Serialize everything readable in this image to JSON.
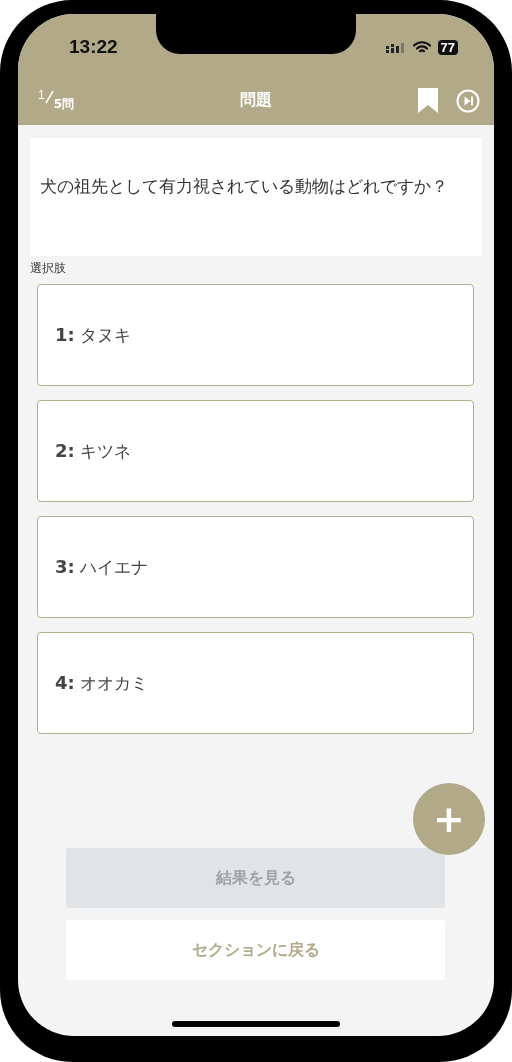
{
  "status_bar": {
    "time": "13:22",
    "battery": "77"
  },
  "header": {
    "counter_current": "1",
    "counter_total": "5問",
    "title": "問題"
  },
  "question": "犬の祖先として有力視されている動物はどれですか？",
  "choices_label": "選択肢",
  "choices": [
    {
      "number": "1:",
      "label": "タヌキ",
      "selected": false
    },
    {
      "number": "2:",
      "label": "キツネ",
      "selected": false
    },
    {
      "number": "3:",
      "label": "ハイエナ",
      "selected": false
    },
    {
      "number": "4:",
      "label": "オオカミ",
      "selected": false
    }
  ],
  "fab": "+",
  "buttons": [
    {
      "label": "結果を見る",
      "disabled": true
    },
    {
      "label": "セクションに戻る",
      "disabled": false
    }
  ]
}
